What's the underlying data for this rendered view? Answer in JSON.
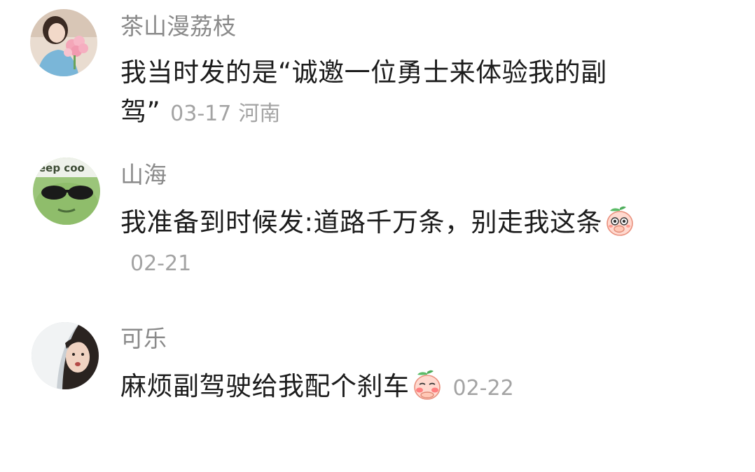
{
  "comments": [
    {
      "username": "茶山漫荔枝",
      "text": "我当时发的是“诚邀一位勇士来体验我的副驾”",
      "date": "03-17",
      "location": "河南",
      "avatar": "avatar-girl-with-flowers"
    },
    {
      "username": "山海",
      "text": "我准备到时候发:道路千万条，别走我这条",
      "emoji": "peach-covering-mouth-emoji",
      "date": "02-21",
      "avatar_text": "eep coo",
      "avatar": "avatar-green-frog-sunglasses"
    },
    {
      "username": "可乐",
      "text": "麻烦副驾驶给我配个刹车",
      "emoji": "peach-blushing-emoji",
      "date": "02-22",
      "avatar": "avatar-girl-white-hood"
    }
  ]
}
